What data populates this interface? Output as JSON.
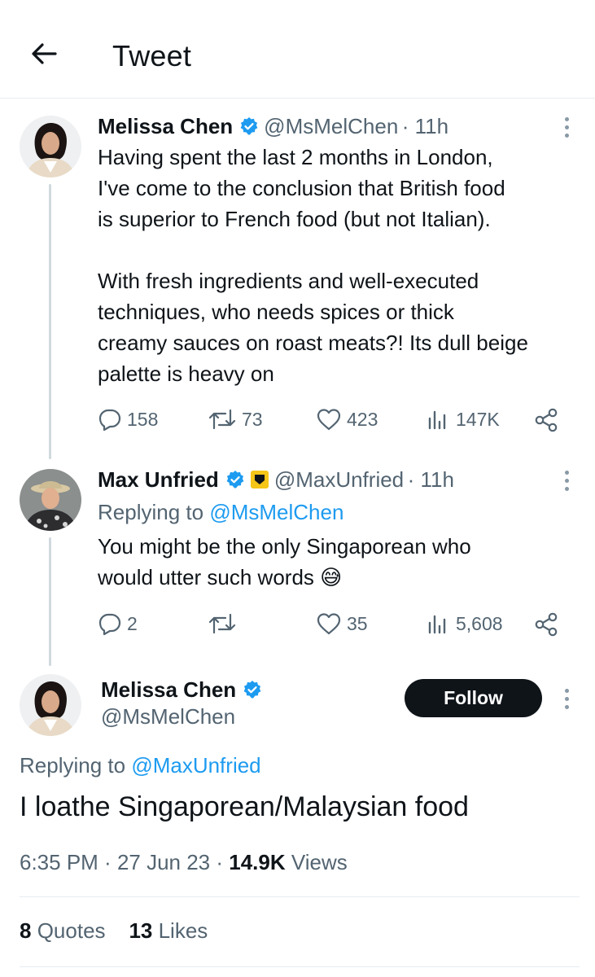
{
  "header": {
    "title": "Tweet"
  },
  "tweets": [
    {
      "name": "Melissa Chen",
      "handle": "@MsMelChen",
      "time": "· 11h",
      "text": "Having spent the last 2 months in London,\nI've come to the conclusion that British food\nis superior to French food (but not Italian).\n\nWith fresh ingredients and well-executed\ntechniques, who needs spices or thick\ncreamy sauces on roast meats?! Its dull beige\npalette is heavy on",
      "replies": "158",
      "retweets": "73",
      "likes": "423",
      "views": "147K"
    },
    {
      "name": "Max Unfried",
      "handle": "@MaxUnfried",
      "time": "· 11h",
      "replying_prefix": "Replying to ",
      "replying_to": "@MsMelChen",
      "text": "You might be the only Singaporean who\nwould utter such words 😅",
      "replies": "2",
      "retweets": "",
      "likes": "35",
      "views": "5,608"
    }
  ],
  "main_tweet": {
    "name": "Melissa Chen",
    "handle": "@MsMelChen",
    "follow_label": "Follow",
    "replying_prefix": "Replying to ",
    "replying_to": "@MaxUnfried",
    "text": "I loathe Singaporean/Malaysian food",
    "time": "6:35 PM",
    "date": "27 Jun 23",
    "views_count": "14.9K",
    "views_label": "Views",
    "quotes_count": "8",
    "quotes_label": "Quotes",
    "likes_count": "13",
    "likes_label": "Likes"
  },
  "colors": {
    "accent": "#1d9bf0",
    "text": "#0f1419",
    "secondary": "#536471",
    "gold": "#f5c518"
  },
  "icons": [
    "back-arrow-icon",
    "verified-badge-icon",
    "gold-badge-icon",
    "more-icon",
    "reply-icon",
    "retweet-icon",
    "like-icon",
    "views-icon",
    "share-icon"
  ]
}
